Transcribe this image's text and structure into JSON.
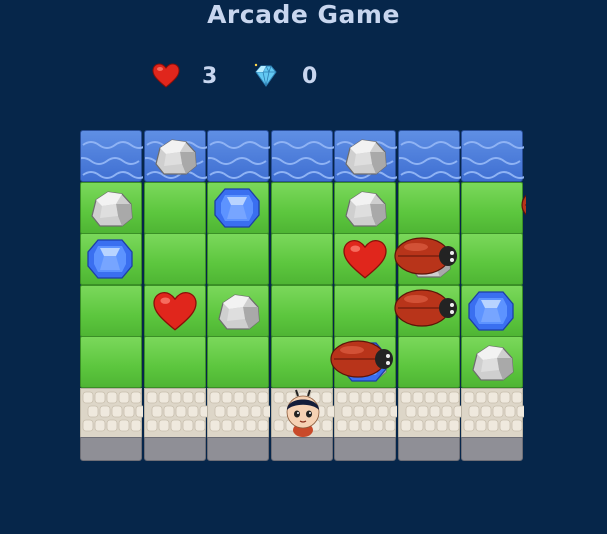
{
  "title": "Arcade Game",
  "hud": {
    "lives_icon": "heart-icon",
    "lives": "3",
    "gems_icon": "diamond-icon",
    "gems": "0"
  },
  "board": {
    "columns": 7,
    "row_types": [
      "water",
      "grass",
      "grass",
      "grass",
      "grass",
      "stone"
    ],
    "rocks": [
      [
        1,
        0
      ],
      [
        4,
        0
      ],
      [
        0,
        1
      ],
      [
        4,
        1
      ],
      [
        5,
        2
      ],
      [
        2,
        3
      ],
      [
        4,
        4
      ],
      [
        6,
        4
      ]
    ],
    "gems": [
      [
        2,
        1
      ],
      [
        0,
        2
      ],
      [
        6,
        3
      ],
      [
        4,
        4
      ]
    ],
    "hearts": [
      [
        4,
        2
      ],
      [
        1,
        3
      ]
    ],
    "bugs": [
      [
        7,
        1
      ],
      [
        5,
        2
      ],
      [
        5,
        3
      ],
      [
        4,
        4
      ]
    ],
    "player": [
      3,
      5
    ]
  },
  "colors": {
    "background": "#06264a",
    "text": "#c8d6ef",
    "heart": "#e0261c",
    "gem": "#3a6ff0",
    "bug": "#b8341a"
  }
}
